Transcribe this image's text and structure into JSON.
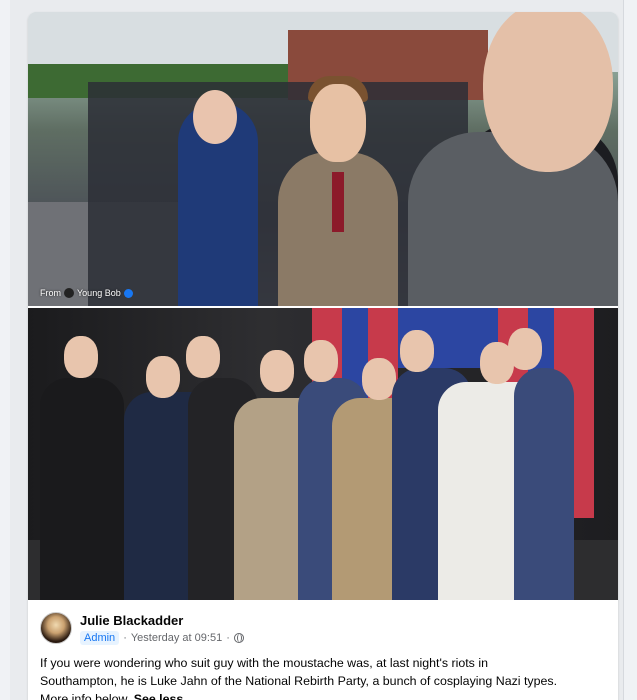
{
  "photos": {
    "top_credit_prefix": "From",
    "top_credit_name": "Young Bob"
  },
  "post": {
    "author": "Julie Blackadder",
    "role_badge": "Admin",
    "timestamp": "Yesterday at 09:51",
    "separator": "·",
    "privacy_icon": "globe-icon",
    "text_line_1": "If you were wondering who suit guy with the moustache was, at last night's riots in",
    "text_line_2": "Southampton, he is Luke Jahn of the National Rebirth Party, a bunch of cosplaying Nazi types.",
    "text_line_3": "More info below.",
    "see_less": "See less"
  },
  "colors": {
    "accent": "#1877f2",
    "background": "#e9ebee",
    "card": "#ffffff",
    "muted_text": "#65676b"
  }
}
